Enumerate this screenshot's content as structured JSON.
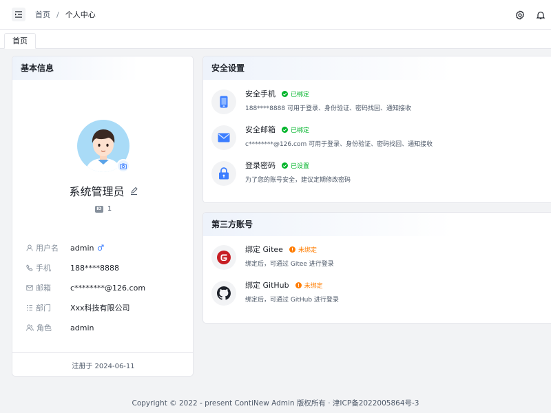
{
  "header": {
    "breadcrumb": [
      "首页",
      "个人中心"
    ],
    "separator": "/",
    "icons": [
      "menu-fold-icon",
      "settings-icon",
      "bell-icon"
    ]
  },
  "tabs": [
    {
      "label": "首页"
    }
  ],
  "basic": {
    "title": "基本信息",
    "name": "系统管理员",
    "id_label": "ID",
    "id_value": "1",
    "fields": [
      {
        "label": "用户名",
        "value": "admin",
        "icon": "user-icon",
        "extra_icon": "male-icon"
      },
      {
        "label": "手机",
        "value": "188****8888",
        "icon": "phone-icon"
      },
      {
        "label": "邮箱",
        "value": "c********@126.com",
        "icon": "mail-icon"
      },
      {
        "label": "部门",
        "value": "Xxx科技有限公司",
        "icon": "department-icon"
      },
      {
        "label": "角色",
        "value": "admin",
        "icon": "role-icon"
      }
    ],
    "registered": "注册于 2024-06-11"
  },
  "security": {
    "title": "安全设置",
    "items": [
      {
        "title": "安全手机",
        "status": "已绑定",
        "desc": "188****8888 可用于登录、身份验证、密码找回、通知接收",
        "icon": "phone-device-icon"
      },
      {
        "title": "安全邮箱",
        "status": "已绑定",
        "desc": "c********@126.com 可用于登录、身份验证、密码找回、通知接收",
        "icon": "envelope-icon"
      },
      {
        "title": "登录密码",
        "status": "已设置",
        "desc": "为了您的账号安全，建议定期修改密码",
        "icon": "lock-icon"
      }
    ]
  },
  "third": {
    "title": "第三方账号",
    "items": [
      {
        "title": "绑定 Gitee",
        "status": "未绑定",
        "desc": "绑定后，可通过 Gitee 进行登录",
        "icon": "gitee-icon"
      },
      {
        "title": "绑定 GitHub",
        "status": "未绑定",
        "desc": "绑定后，可通过 GitHub 进行登录",
        "icon": "github-icon"
      }
    ]
  },
  "footer": {
    "text": "Copyright © 2022 - present ContiNew Admin 版权所有 · 津ICP备2022005864号-3"
  },
  "colors": {
    "success": "#00b42a",
    "warning": "#ff7d00",
    "primary": "#3c7eff",
    "gitee": "#c71d23"
  }
}
